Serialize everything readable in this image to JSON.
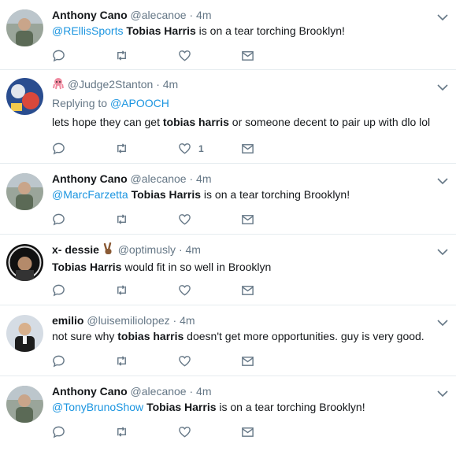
{
  "tweets": [
    {
      "fullname": "Anthony Cano",
      "handle": "@alecanoe",
      "dot": "·",
      "time": "4m",
      "mention": "@REllisSports",
      "bold": "Tobias Harris",
      "rest": " is on a tear torching Brooklyn!"
    },
    {
      "handle": "@Judge2Stanton",
      "dot": "·",
      "time": "4m",
      "replying_label": "Replying to",
      "replying_to": "@APOOCH",
      "pre": "lets hope they can get ",
      "bold": "tobias harris",
      "rest": " or someone decent to pair up with dlo lol",
      "like_count": "1"
    },
    {
      "fullname": "Anthony Cano",
      "handle": "@alecanoe",
      "dot": "·",
      "time": "4m",
      "mention": "@MarcFarzetta",
      "bold": "Tobias Harris",
      "rest": " is on a tear torching Brooklyn!"
    },
    {
      "fullname": "x- dessie",
      "handle": "@optimusly",
      "dot": "·",
      "time": "4m",
      "bold": "Tobias Harris",
      "rest": " would fit in so well in Brooklyn"
    },
    {
      "fullname": "emilio",
      "handle": "@luisemiliolopez",
      "dot": "·",
      "time": "4m",
      "pre": "not sure why ",
      "bold": "tobias harris",
      "rest": " doesn't get more opportunities. guy is very good."
    },
    {
      "fullname": "Anthony Cano",
      "handle": "@alecanoe",
      "dot": "·",
      "time": "4m",
      "mention": "@TonyBrunoShow",
      "bold": "Tobias Harris",
      "rest": " is on a tear torching Brooklyn!"
    }
  ],
  "colors": {
    "link": "#1b95e0",
    "secondary": "#657786",
    "text": "#14171a",
    "border": "#e6ecf0"
  }
}
